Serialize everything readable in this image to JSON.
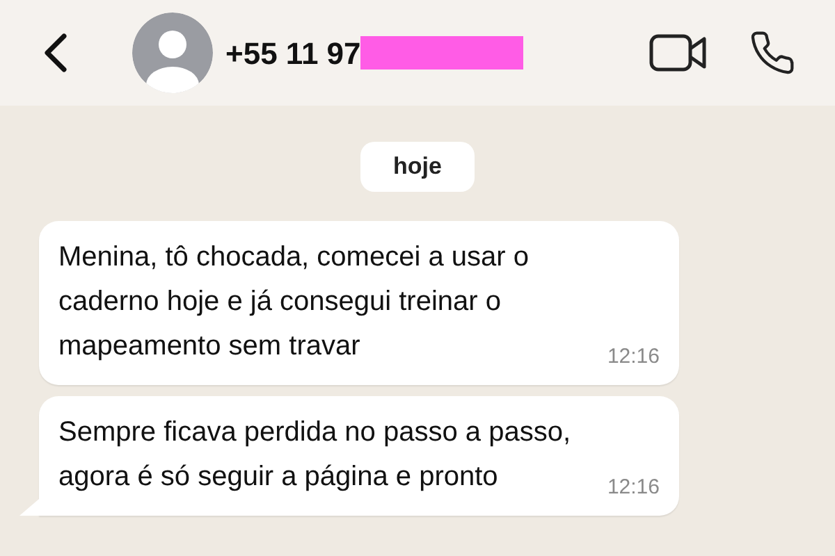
{
  "header": {
    "contact": "+55 11 97",
    "redacted": true
  },
  "date_chip": "hoje",
  "messages": [
    {
      "text": "Menina, tô chocada, comecei a usar o caderno hoje e já consegui treinar o mapeamento sem travar",
      "time": "12:16",
      "tail": false
    },
    {
      "text": "Sempre ficava perdida no passo a passo, agora é só seguir a página e pronto",
      "time": "12:16",
      "tail": true
    }
  ]
}
